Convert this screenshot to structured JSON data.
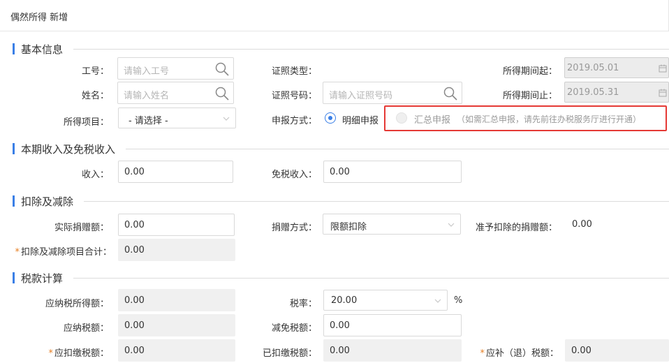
{
  "page": {
    "title": "偶然所得 新增"
  },
  "sections": {
    "basic": "基本信息",
    "income": "本期收入及免税收入",
    "deduction": "扣除及减除",
    "tax": "税款计算"
  },
  "basic": {
    "employee_id": {
      "label": "工号：",
      "placeholder": "请输入工号"
    },
    "name": {
      "label": "姓名：",
      "placeholder": "请输入姓名"
    },
    "income_item": {
      "label": "所得项目：",
      "value": "- 请选择 -"
    },
    "id_type": {
      "label": "证照类型："
    },
    "id_number": {
      "label": "证照号码：",
      "placeholder": "请输入证照号码"
    },
    "report_method": {
      "label": "申报方式：",
      "option_detail": "明细申报",
      "option_summary": "汇总申报",
      "summary_hint": "（如需汇总申报，请先前往办税服务厅进行开通）"
    },
    "period_start": {
      "label": "所得期间起：",
      "value": "2019.05.01"
    },
    "period_end": {
      "label": "所得期间止：",
      "value": "2019.05.31"
    }
  },
  "income": {
    "income": {
      "label": "收入：",
      "value": "0.00"
    },
    "tax_free": {
      "label": "免税收入：",
      "value": "0.00"
    }
  },
  "deduction": {
    "donation": {
      "label": "实际捐赠额：",
      "value": "0.00"
    },
    "donation_method": {
      "label": "捐赠方式：",
      "value": "限额扣除"
    },
    "allowed_donation": {
      "label": "准予扣除的捐赠额：",
      "value": "0.00"
    },
    "total": {
      "label": "扣除及减除项目合计：",
      "value": "0.00",
      "required": "*"
    }
  },
  "tax": {
    "taxable_income": {
      "label": "应纳税所得额：",
      "value": "0.00"
    },
    "rate": {
      "label": "税率：",
      "value": "20.00",
      "unit": "%"
    },
    "tax_payable": {
      "label": "应纳税额：",
      "value": "0.00"
    },
    "tax_reduction": {
      "label": "减免税额：",
      "value": "0.00"
    },
    "withholding": {
      "label": "应扣缴税额：",
      "value": "0.00",
      "required": "*"
    },
    "withheld": {
      "label": "已扣缴税额：",
      "value": "0.00"
    },
    "refund": {
      "label": "应补（退）税额：",
      "value": "0.00",
      "required": "*"
    }
  },
  "colors": {
    "accent": "#3a7fe6",
    "highlight": "#e53935",
    "required": "#e67e22"
  }
}
